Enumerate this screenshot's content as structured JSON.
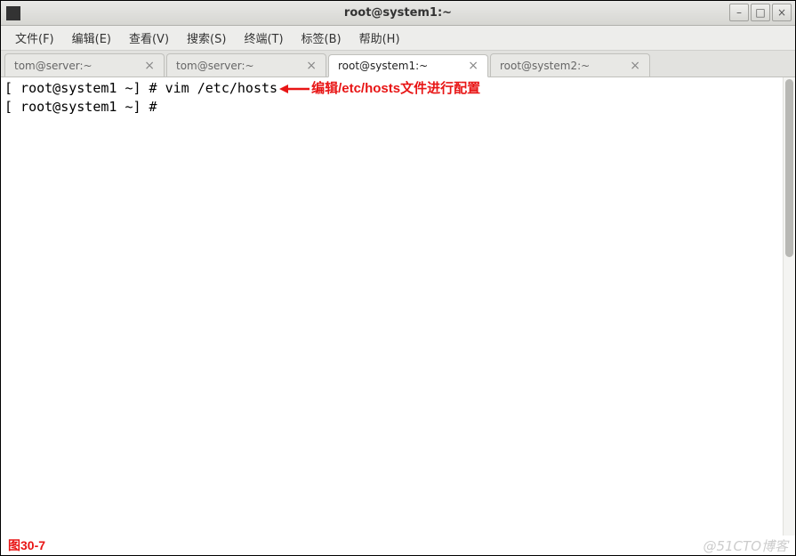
{
  "titlebar": {
    "title": "root@system1:~"
  },
  "menubar": {
    "items": [
      "文件(F)",
      "编辑(E)",
      "查看(V)",
      "搜索(S)",
      "终端(T)",
      "标签(B)",
      "帮助(H)"
    ]
  },
  "tabs": [
    {
      "label": "tom@server:~",
      "active": false
    },
    {
      "label": "tom@server:~",
      "active": false
    },
    {
      "label": "root@system1:~",
      "active": true
    },
    {
      "label": "root@system2:~",
      "active": false
    }
  ],
  "terminal": {
    "lines": [
      {
        "prompt": "[ root@system1 ~] # ",
        "command": "vim /etc/hosts",
        "annotation": "编辑/etc/hosts文件进行配置"
      },
      {
        "prompt": "[ root@system1 ~] # ",
        "command": "",
        "annotation": ""
      }
    ]
  },
  "footer": {
    "figure_label": "图30-7",
    "watermark": "@51CTO博客"
  },
  "window_controls": {
    "minimize": "–",
    "maximize": "□",
    "close": "×"
  },
  "tab_close_glyph": "×"
}
